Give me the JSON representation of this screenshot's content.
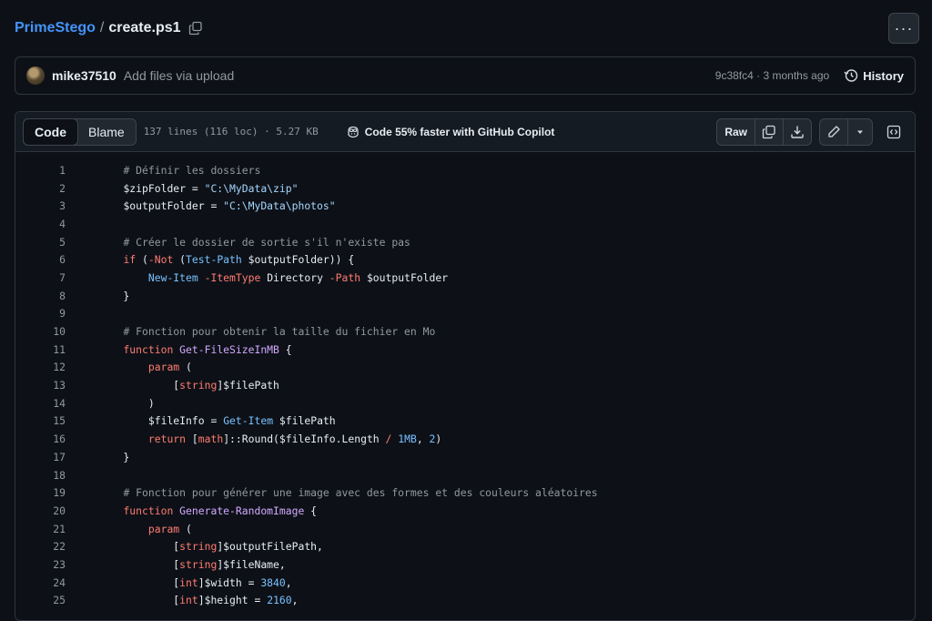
{
  "breadcrumb": {
    "repo": "PrimeStego",
    "separator": "/",
    "file": "create.ps1"
  },
  "menu": {
    "kebab": "···"
  },
  "commit": {
    "user": "mike37510",
    "message": "Add files via upload",
    "meta": "9c38fc4 · 3 months ago",
    "history_label": "History"
  },
  "file_header": {
    "tabs": [
      "Code",
      "Blame"
    ],
    "active_tab": "Code",
    "info": "137 lines (116 loc) · 5.27 KB",
    "copilot": "Code 55% faster with GitHub Copilot",
    "raw_label": "Raw"
  },
  "code_lines": [
    {
      "n": "1",
      "t": "    # Définir les dossiers"
    },
    {
      "n": "2",
      "t": "    $zipFolder = \"C:\\MyData\\zip\""
    },
    {
      "n": "3",
      "t": "    $outputFolder = \"C:\\MyData\\photos\""
    },
    {
      "n": "4",
      "t": ""
    },
    {
      "n": "5",
      "t": "    # Créer le dossier de sortie s'il n'existe pas"
    },
    {
      "n": "6",
      "t": "    if (-Not (Test-Path $outputFolder)) {"
    },
    {
      "n": "7",
      "t": "        New-Item -ItemType Directory -Path $outputFolder"
    },
    {
      "n": "8",
      "t": "    }"
    },
    {
      "n": "9",
      "t": ""
    },
    {
      "n": "10",
      "t": "    # Fonction pour obtenir la taille du fichier en Mo"
    },
    {
      "n": "11",
      "t": "    function Get-FileSizeInMB {"
    },
    {
      "n": "12",
      "t": "        param ("
    },
    {
      "n": "13",
      "t": "            [string]$filePath"
    },
    {
      "n": "14",
      "t": "        )"
    },
    {
      "n": "15",
      "t": "        $fileInfo = Get-Item $filePath"
    },
    {
      "n": "16",
      "t": "        return [math]::Round($fileInfo.Length / 1MB, 2)"
    },
    {
      "n": "17",
      "t": "    }"
    },
    {
      "n": "18",
      "t": ""
    },
    {
      "n": "19",
      "t": "    # Fonction pour générer une image avec des formes et des couleurs aléatoires"
    },
    {
      "n": "20",
      "t": "    function Generate-RandomImage {"
    },
    {
      "n": "21",
      "t": "        param ("
    },
    {
      "n": "22",
      "t": "            [string]$outputFilePath,"
    },
    {
      "n": "23",
      "t": "            [string]$fileName,"
    },
    {
      "n": "24",
      "t": "            [int]$width = 3840,"
    },
    {
      "n": "25",
      "t": "            [int]$height = 2160,"
    }
  ]
}
